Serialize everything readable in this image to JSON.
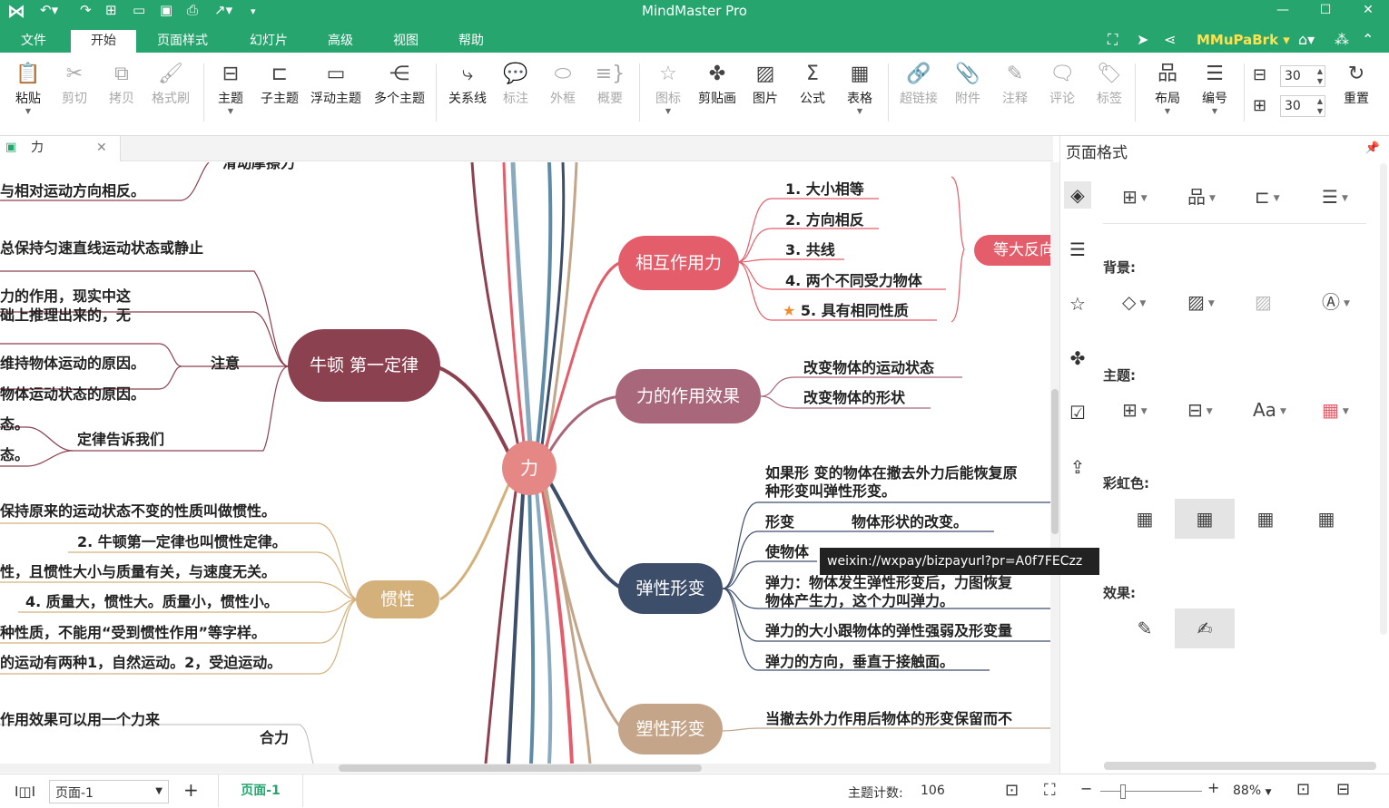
{
  "app": {
    "title": "MindMaster Pro",
    "user": "MMuPaBrk"
  },
  "menus": [
    "文件",
    "开始",
    "页面样式",
    "幻灯片",
    "高级",
    "视图",
    "帮助"
  ],
  "ribbon": {
    "paste": "粘贴",
    "cut": "剪切",
    "copy": "拷贝",
    "format_painter": "格式刷",
    "topic": "主题",
    "subtopic": "子主题",
    "floating_topic": "浮动主题",
    "multiple_topics": "多个主题",
    "relation": "关系线",
    "callout": "标注",
    "boundary": "外框",
    "summary": "概要",
    "icon": "图标",
    "clipart": "剪贴画",
    "picture": "图片",
    "formula": "公式",
    "table": "表格",
    "hyperlink": "超链接",
    "attachment": "附件",
    "note": "注释",
    "comment": "评论",
    "tag": "标签",
    "layout": "布局",
    "numbering": "编号",
    "spacing_h": "30",
    "spacing_v": "30",
    "reset": "重置"
  },
  "doc_tab": {
    "name": "力"
  },
  "mindmap": {
    "center": "力",
    "branches": {
      "interaction": {
        "label": "相互作用力",
        "color": "#e45d6a",
        "items": [
          "1. 大小相等",
          "2. 方向相反",
          "3. 共线",
          "4. 两个不同受力物体",
          "5. 具有相同性质"
        ],
        "summary": "等大反向"
      },
      "effect": {
        "label": "力的作用效果",
        "color": "#a8677a",
        "items": [
          "改变物体的运动状态",
          "改变物体的形状"
        ]
      },
      "elastic": {
        "label": "弹性形变",
        "color": "#3d4e6b",
        "items": [
          "如果形  变的物体在撤去外力后能恢复原",
          "种形变叫弹性形变。",
          "形变",
          "物体形状的改变。",
          "使物体",
          "弹力：物体发生弹性形变后，力图恢复",
          "物体产生力，这个力叫弹力。",
          "弹力的大小跟物体的弹性强弱及形变量",
          "弹力的方向，垂直于接触面。"
        ]
      },
      "plastic": {
        "label": "塑性形变",
        "color": "#c4a589",
        "items": [
          "当撤去外力作用后物体的形变保留而不"
        ]
      },
      "newton": {
        "label": "牛顿  第一定律",
        "color": "#8c4150",
        "items": [
          "与相对运动方向相反。",
          "总保持匀速直线运动状态或静止",
          "力的作用，现实中这",
          "础上推理出来的，无",
          "注意",
          "维持物体运动的原因。",
          "物体运动状态的原因。",
          "态。",
          "定律告诉我们",
          "态。"
        ]
      },
      "inertia": {
        "label": "惯性",
        "color": "#d4b07a",
        "items": [
          "保持原来的运动状态不变的性质叫做惯性。",
          "2. 牛顿第一定律也叫惯性定律。",
          "性，且惯性大小与质量有关，与速度无关。",
          "4. 质量大，惯性大。质量小，惯性小。",
          "种性质，不能用“受到惯性作用”等字样。",
          "的运动有两种1，自然运动。2，受迫运动。"
        ]
      },
      "resultant": {
        "items": [
          "作用效果可以用一个力来",
          "合力"
        ]
      },
      "friction": {
        "items": [
          "滑动摩擦力"
        ]
      }
    }
  },
  "tooltip": "weixin://wxpay/bizpayurl?pr=A0f7FECzz",
  "panel": {
    "title": "页面格式",
    "background_label": "背景:",
    "theme_label": "主题:",
    "rainbow_label": "彩虹色:",
    "effect_label": "效果:",
    "font_sample": "Aa"
  },
  "status": {
    "page_select": "页面-1",
    "page_tab": "页面-1",
    "topic_count_label": "主题计数:",
    "topic_count": "106",
    "zoom": "88%"
  }
}
